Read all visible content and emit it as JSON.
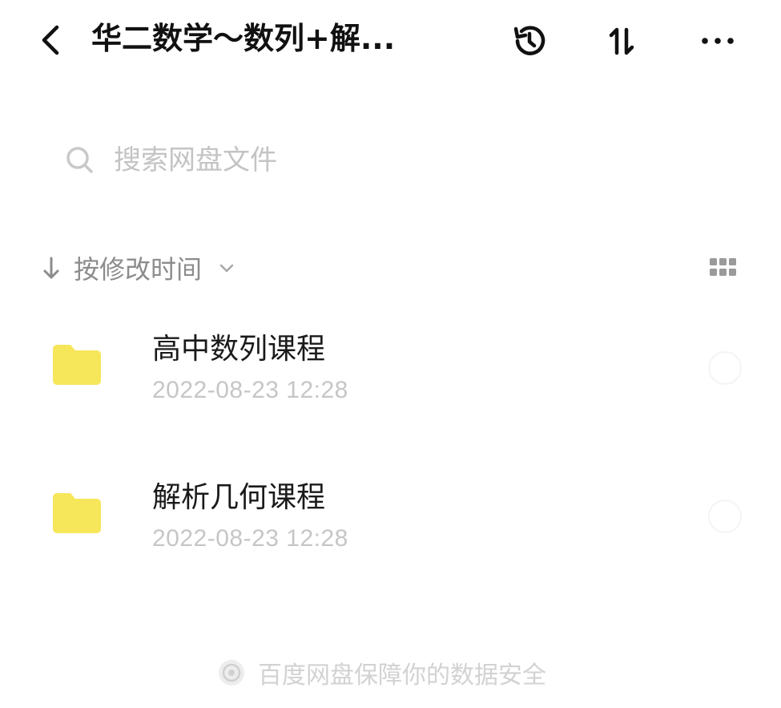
{
  "header": {
    "title": "华二数学～数列+解...",
    "icons": [
      "back-arrow-icon",
      "history-icon",
      "sort-icon",
      "more-icon"
    ]
  },
  "search": {
    "placeholder": "搜索网盘文件"
  },
  "sort": {
    "label": "按修改时间"
  },
  "files": [
    {
      "name": "高中数列课程",
      "modified": "2022-08-23  12:28",
      "type": "folder"
    },
    {
      "name": "解析几何课程",
      "modified": "2022-08-23  12:28",
      "type": "folder"
    }
  ],
  "footer": {
    "text": "百度网盘保障你的数据安全"
  },
  "colors": {
    "folder": "#f6e65a",
    "text_primary": "#1a1a1a",
    "text_secondary": "#8c8c8c",
    "text_muted": "#c6c6c6"
  }
}
